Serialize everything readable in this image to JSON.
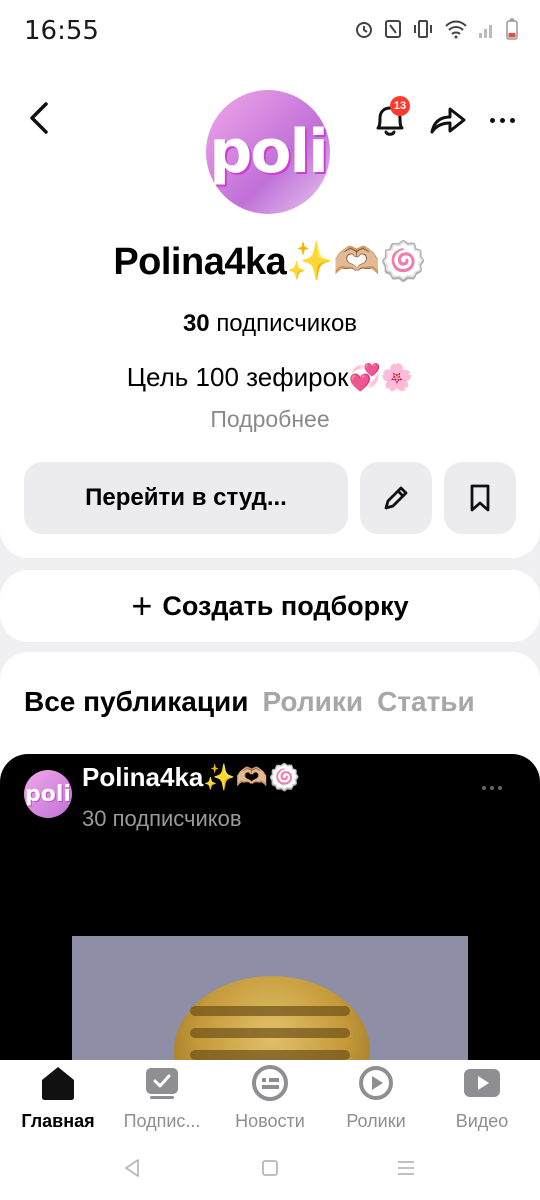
{
  "status_bar": {
    "time": "16:55"
  },
  "header": {
    "back_icon": "chevron-left-icon",
    "avatar_text": "poli",
    "notifications_badge": "13",
    "share_icon": "share-arrow-icon",
    "more_icon": "more-horizontal-icon"
  },
  "profile": {
    "name": "Polina4ka✨🫶🏼🍥",
    "subscribers_count": "30",
    "subscribers_label": "подписчиков",
    "description": "Цель 100 зефирок💞🌸",
    "more_link": "Подробнее"
  },
  "actions": {
    "studio_button": "Перейти в студ...",
    "edit_icon": "pencil-icon",
    "bookmark_icon": "bookmark-icon"
  },
  "create_collection": {
    "label": "Создать подборку"
  },
  "tabs": [
    {
      "label": "Все публикации",
      "active": true
    },
    {
      "label": "Ролики",
      "active": false
    },
    {
      "label": "Статьи",
      "active": false
    }
  ],
  "post": {
    "author_avatar_text": "poli",
    "author_name": "Polina4ka✨🫶🏼🍥",
    "author_subscribers": "30 подписчиков"
  },
  "bottom_nav": [
    {
      "label": "Главная",
      "icon": "home-icon",
      "active": true
    },
    {
      "label": "Подпис...",
      "icon": "subscriptions-icon",
      "active": false
    },
    {
      "label": "Новости",
      "icon": "news-icon",
      "active": false
    },
    {
      "label": "Ролики",
      "icon": "clips-icon",
      "active": false
    },
    {
      "label": "Видео",
      "icon": "video-icon",
      "active": false
    }
  ],
  "colors": {
    "badge": "#ff3b30",
    "inactive_tab": "#a7a7ab",
    "surface": "#ececee"
  }
}
